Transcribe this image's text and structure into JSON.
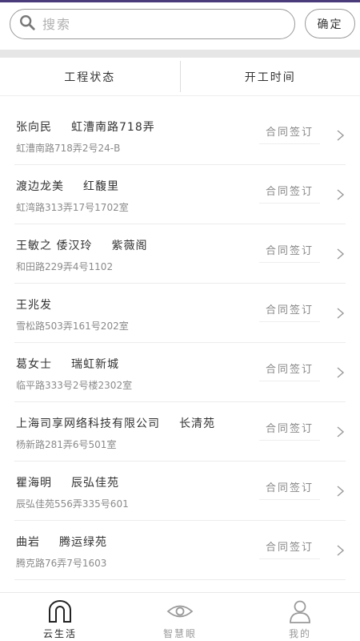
{
  "search": {
    "placeholder": "搜索",
    "confirm_label": "确定"
  },
  "filters": [
    {
      "label": "工程状态"
    },
    {
      "label": "开工时间"
    }
  ],
  "projects": [
    {
      "owner": "张向民",
      "community": "虹漕南路718弄",
      "address": "虹漕南路718弄2号24-B",
      "status": "合同签订"
    },
    {
      "owner": "渡边龙美",
      "community": "红馥里",
      "address": "虹湾路313弄17号1702室",
      "status": "合同签订"
    },
    {
      "owner": "王敏之 倭汉玲",
      "community": "紫薇阁",
      "address": "和田路229弄4号1102",
      "status": "合同签订"
    },
    {
      "owner": "王兆发",
      "community": "",
      "address": "雪松路503弄161号202室",
      "status": "合同签订"
    },
    {
      "owner": "葛女士",
      "community": "瑞虹新城",
      "address": "临平路333号2号楼2302室",
      "status": "合同签订"
    },
    {
      "owner": "上海司享网络科技有限公司",
      "community": "长清苑",
      "address": "杨新路281弄6号501室",
      "status": "合同签订"
    },
    {
      "owner": "瞿海明",
      "community": "辰弘佳苑",
      "address": "辰弘佳苑556弄335号601",
      "status": "合同签订"
    },
    {
      "owner": "曲岩",
      "community": "腾运绿苑",
      "address": "腾克路76弄7号1603",
      "status": "合同签订"
    }
  ],
  "tabbar": [
    {
      "label": "云生活",
      "icon": "home-arch-icon",
      "active": true
    },
    {
      "label": "智慧眼",
      "icon": "eye-icon",
      "active": false
    },
    {
      "label": "我的",
      "icon": "user-icon",
      "active": false
    }
  ],
  "colors": {
    "accent": "#4a3b7a",
    "text": "#333333",
    "subtext": "#8a8a8a"
  }
}
